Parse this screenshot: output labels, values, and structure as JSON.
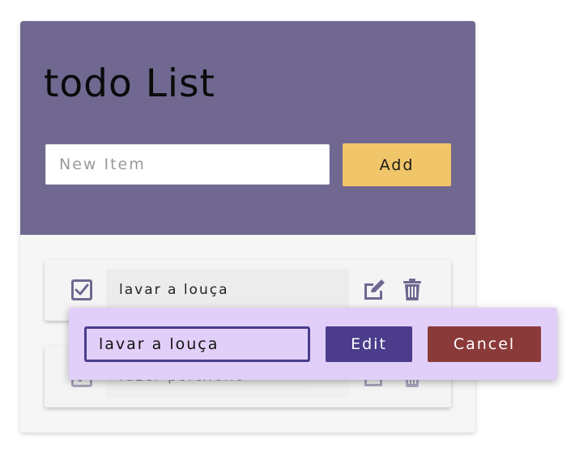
{
  "app": {
    "title": "todo List"
  },
  "new_item": {
    "placeholder": "New Item",
    "value": "",
    "add_label": "Add"
  },
  "items": [
    {
      "text": "lavar a louça",
      "checked": true
    },
    {
      "text": "fazer portifolio",
      "checked": true
    }
  ],
  "edit_popup": {
    "value": "lavar a louça",
    "edit_label": "Edit",
    "cancel_label": "Cancel"
  },
  "colors": {
    "header": "#716891",
    "add_button": "#f1c569",
    "edit_button": "#4b3c8c",
    "cancel_button": "#8b3a3a",
    "popup": "#e1cff9"
  },
  "icons": {
    "checkbox": "checkbox-checked-icon",
    "edit": "pencil-square-icon",
    "delete": "trash-icon"
  }
}
